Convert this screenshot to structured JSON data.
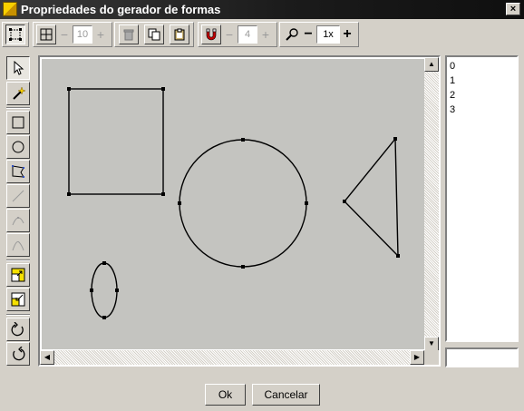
{
  "window": {
    "title": "Propriedades do gerador de formas",
    "close_label": "×"
  },
  "toolbar": {
    "grid_spin_value": "10",
    "snap_spin_value": "4",
    "zoom_value": "1x",
    "minus": "−",
    "plus": "+"
  },
  "shape_list": [
    "0",
    "1",
    "2",
    "3"
  ],
  "buttons": {
    "ok": "Ok",
    "cancel": "Cancelar"
  }
}
